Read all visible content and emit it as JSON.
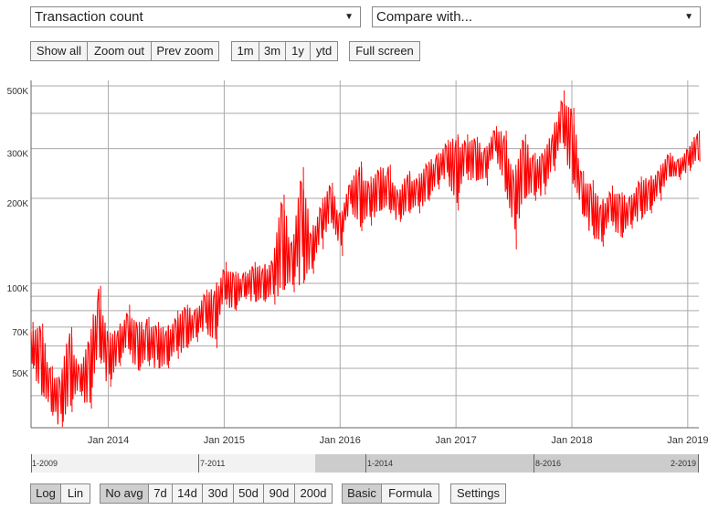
{
  "selectors": {
    "metric": "Transaction count",
    "compare": "Compare with..."
  },
  "zoom_buttons": [
    "Show all",
    "Zoom out",
    "Prev zoom"
  ],
  "range_buttons": [
    "1m",
    "3m",
    "1y",
    "ytd"
  ],
  "fullscreen_label": "Full screen",
  "scale_buttons": [
    {
      "label": "Log",
      "active": true
    },
    {
      "label": "Lin",
      "active": false
    }
  ],
  "avg_buttons": [
    {
      "label": "No avg",
      "active": true
    },
    {
      "label": "7d"
    },
    {
      "label": "14d"
    },
    {
      "label": "30d"
    },
    {
      "label": "50d"
    },
    {
      "label": "90d"
    },
    {
      "label": "200d"
    }
  ],
  "mode_buttons": [
    {
      "label": "Basic",
      "active": true
    },
    {
      "label": "Formula"
    }
  ],
  "settings_label": "Settings",
  "navigator": {
    "labels": [
      "1-2009",
      "7-2011",
      "1-2014",
      "8-2016",
      "2-2019"
    ],
    "selected_from": "2014-01",
    "selected_to": "2019-02"
  },
  "chart_data": {
    "type": "line",
    "scale": "log",
    "line_color": "#ff0000",
    "grid": true,
    "ylim": [
      30800,
      523000
    ],
    "xlim": [
      "2013-05",
      "2019-02"
    ],
    "y_ticks": [
      {
        "v": 500000,
        "label": "500K"
      },
      {
        "v": 300000,
        "label": "300K"
      },
      {
        "v": 200000,
        "label": "200K"
      },
      {
        "v": 100000,
        "label": "100K"
      },
      {
        "v": 70000,
        "label": "70K"
      },
      {
        "v": 50000,
        "label": "50K"
      }
    ],
    "y_gridlines": [
      500000,
      400000,
      300000,
      200000,
      100000,
      90000,
      80000,
      70000,
      60000,
      50000,
      40000
    ],
    "x_ticks": [
      {
        "d": "2014-01",
        "label": "Jan 2014"
      },
      {
        "d": "2015-01",
        "label": "Jan 2015"
      },
      {
        "d": "2016-01",
        "label": "Jan 2016"
      },
      {
        "d": "2017-01",
        "label": "Jan 2017"
      },
      {
        "d": "2018-01",
        "label": "Jan 2018"
      },
      {
        "d": "2019-01",
        "label": "Jan 2019"
      }
    ],
    "monthly_high_low_thousands": [
      [
        "2013-05",
        73,
        50
      ],
      [
        "2013-06",
        72,
        41
      ],
      [
        "2013-07",
        51,
        34
      ],
      [
        "2013-08",
        48,
        31
      ],
      [
        "2013-09",
        70,
        35
      ],
      [
        "2013-10",
        52,
        40
      ],
      [
        "2013-11",
        65,
        36
      ],
      [
        "2013-12",
        98,
        52
      ],
      [
        "2014-01",
        67,
        43
      ],
      [
        "2014-02",
        70,
        51
      ],
      [
        "2014-03",
        84,
        56
      ],
      [
        "2014-04",
        73,
        49
      ],
      [
        "2014-05",
        76,
        51
      ],
      [
        "2014-06",
        73,
        50
      ],
      [
        "2014-07",
        70,
        50
      ],
      [
        "2014-08",
        80,
        54
      ],
      [
        "2014-09",
        84,
        59
      ],
      [
        "2014-10",
        82,
        62
      ],
      [
        "2014-11",
        95,
        69
      ],
      [
        "2014-12",
        98,
        59
      ],
      [
        "2015-01",
        119,
        84
      ],
      [
        "2015-02",
        110,
        80
      ],
      [
        "2015-03",
        110,
        88
      ],
      [
        "2015-04",
        119,
        86
      ],
      [
        "2015-05",
        116,
        86
      ],
      [
        "2015-06",
        128,
        84
      ],
      [
        "2015-07",
        206,
        95
      ],
      [
        "2015-08",
        142,
        93
      ],
      [
        "2015-09",
        258,
        100
      ],
      [
        "2015-10",
        153,
        108
      ],
      [
        "2015-11",
        200,
        132
      ],
      [
        "2015-12",
        227,
        168
      ],
      [
        "2016-01",
        181,
        125
      ],
      [
        "2016-02",
        232,
        186
      ],
      [
        "2016-03",
        270,
        153
      ],
      [
        "2016-04",
        239,
        160
      ],
      [
        "2016-05",
        258,
        181
      ],
      [
        "2016-06",
        263,
        177
      ],
      [
        "2016-07",
        215,
        165
      ],
      [
        "2016-08",
        250,
        177
      ],
      [
        "2016-09",
        245,
        177
      ],
      [
        "2016-10",
        270,
        196
      ],
      [
        "2016-11",
        290,
        215
      ],
      [
        "2016-12",
        322,
        239
      ],
      [
        "2017-01",
        337,
        181
      ],
      [
        "2017-02",
        337,
        232
      ],
      [
        "2017-03",
        330,
        232
      ],
      [
        "2017-04",
        306,
        222
      ],
      [
        "2017-05",
        360,
        290
      ],
      [
        "2017-06",
        347,
        215
      ],
      [
        "2017-07",
        263,
        132
      ],
      [
        "2017-08",
        337,
        200
      ],
      [
        "2017-09",
        290,
        196
      ],
      [
        "2017-10",
        299,
        206
      ],
      [
        "2017-11",
        347,
        250
      ],
      [
        "2017-12",
        482,
        299
      ],
      [
        "2018-01",
        418,
        232
      ],
      [
        "2018-02",
        250,
        172
      ],
      [
        "2018-03",
        232,
        148
      ],
      [
        "2018-04",
        196,
        135
      ],
      [
        "2018-05",
        222,
        160
      ],
      [
        "2018-06",
        210,
        145
      ],
      [
        "2018-07",
        206,
        156
      ],
      [
        "2018-08",
        239,
        168
      ],
      [
        "2018-09",
        239,
        177
      ],
      [
        "2018-10",
        263,
        196
      ],
      [
        "2018-11",
        290,
        239
      ],
      [
        "2018-12",
        278,
        232
      ],
      [
        "2019-01",
        306,
        250
      ],
      [
        "2019-02",
        347,
        270
      ]
    ]
  }
}
